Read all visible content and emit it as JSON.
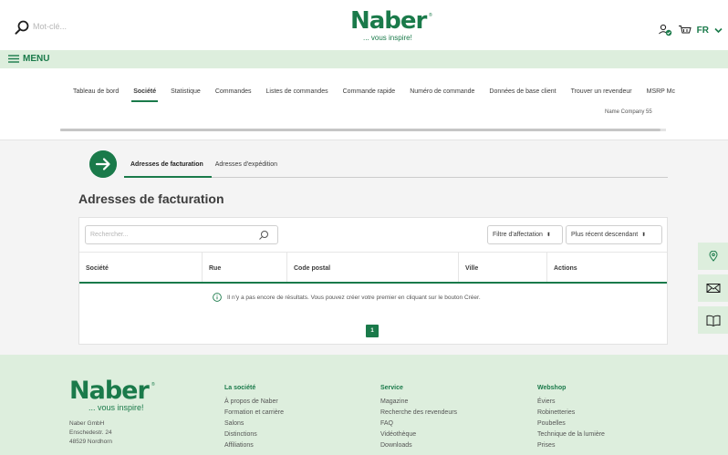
{
  "header": {
    "search_placeholder": "Mot-clé...",
    "logo_text": "Naber",
    "logo_registered": "®",
    "logo_tagline": "... vous inspire!",
    "language": "FR"
  },
  "menu": {
    "label": "MENU"
  },
  "top_nav": {
    "items": [
      {
        "label": "Tableau de bord"
      },
      {
        "label": "Société",
        "active": true
      },
      {
        "label": "Statistique"
      },
      {
        "label": "Commandes"
      },
      {
        "label": "Listes de commandes"
      },
      {
        "label": "Commande rapide"
      },
      {
        "label": "Numéro de commande"
      },
      {
        "label": "Données de base client"
      },
      {
        "label": "Trouver un revendeur"
      },
      {
        "label": "MSRP Mc"
      }
    ],
    "company_name": "Name Company 55"
  },
  "content": {
    "tabs": [
      {
        "label": "Adresses de facturation",
        "active": true
      },
      {
        "label": "Adresses d'expédition"
      }
    ],
    "page_title": "Adresses de facturation",
    "search_placeholder": "Rechercher...",
    "filter_select": "Filtre d'affectation",
    "sort_select": "Plus récent descendant",
    "columns": [
      "Société",
      "Rue",
      "Code postal",
      "Ville",
      "Actions"
    ],
    "empty_message": "Il n'y a pas encore de résultats. Vous pouvez créer votre premier en cliquant sur le bouton Créer.",
    "current_page": "1"
  },
  "footer": {
    "logo_text": "Naber",
    "logo_registered": "®",
    "logo_tagline": "... vous inspire!",
    "address": [
      "Naber GmbH",
      "Enschedestr. 24",
      "48529 Nordhorn"
    ],
    "columns": [
      {
        "heading": "La société",
        "links": [
          "À propos de Naber",
          "Formation et carrière",
          "Salons",
          "Distinctions",
          "Affiliations"
        ]
      },
      {
        "heading": "Service",
        "links": [
          "Magazine",
          "Recherche des revendeurs",
          "FAQ",
          "Vidéothèque",
          "Downloads"
        ]
      },
      {
        "heading": "Webshop",
        "links": [
          "Éviers",
          "Robinetteries",
          "Poubelles",
          "Technique de la lumière",
          "Prises"
        ]
      }
    ]
  },
  "colors": {
    "brand_green": "#1a7a4a",
    "light_green_bg": "#ddeedd",
    "content_bg": "#f4f4f4"
  },
  "icons": {
    "header": [
      "search-icon",
      "user-check-icon",
      "cart-icon",
      "chevron-down-icon"
    ],
    "menu": "hamburger-icon",
    "side": [
      "location-pin-icon",
      "mail-icon",
      "book-icon"
    ]
  }
}
